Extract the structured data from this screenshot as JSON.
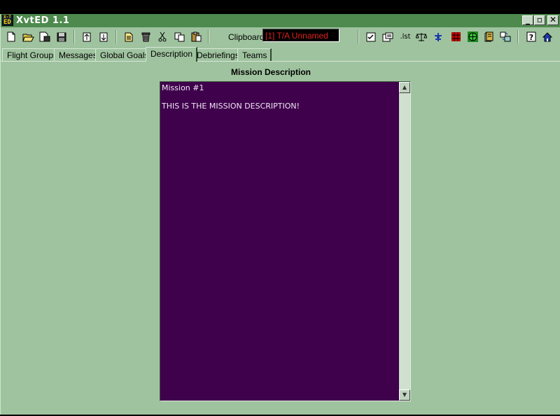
{
  "window": {
    "title": "XvtED 1.1",
    "logo_top": "X-T",
    "logo_bottom": "ED",
    "minimize": "_",
    "restore": "▫",
    "close": "✕"
  },
  "toolbar": {
    "clipboard_label": "Clipboard:",
    "clipboard_value": "[1] T/A Unnamed",
    "lst_label": ".lst",
    "icons": [
      "new-icon",
      "open-icon",
      "save-as-icon",
      "save-icon",
      "move-up-icon",
      "move-down-icon",
      "copy-doc-icon",
      "delete-icon",
      "cut-icon",
      "copy-icon",
      "paste-icon",
      "checklist-icon",
      "report-icon",
      "lst-icon",
      "scales-icon",
      "fighter-icon",
      "grid-icon",
      "globe-icon",
      "book-icon",
      "convert-icon",
      "help-icon",
      "home-icon"
    ]
  },
  "tabs": [
    {
      "label": "Flight Groups"
    },
    {
      "label": "Messages"
    },
    {
      "label": "Global Goals"
    },
    {
      "label": "Description",
      "active": true
    },
    {
      "label": "Debriefings"
    },
    {
      "label": "Teams"
    }
  ],
  "description": {
    "heading": "Mission Description",
    "text": "Mission #1\n\nTHIS IS THE MISSION DESCRIPTION!"
  },
  "colors": {
    "background": "#9fc39f",
    "titlebar": "#4e8a4e",
    "description_bg": "#3f004c",
    "clipboard_text": "#e0201c"
  }
}
